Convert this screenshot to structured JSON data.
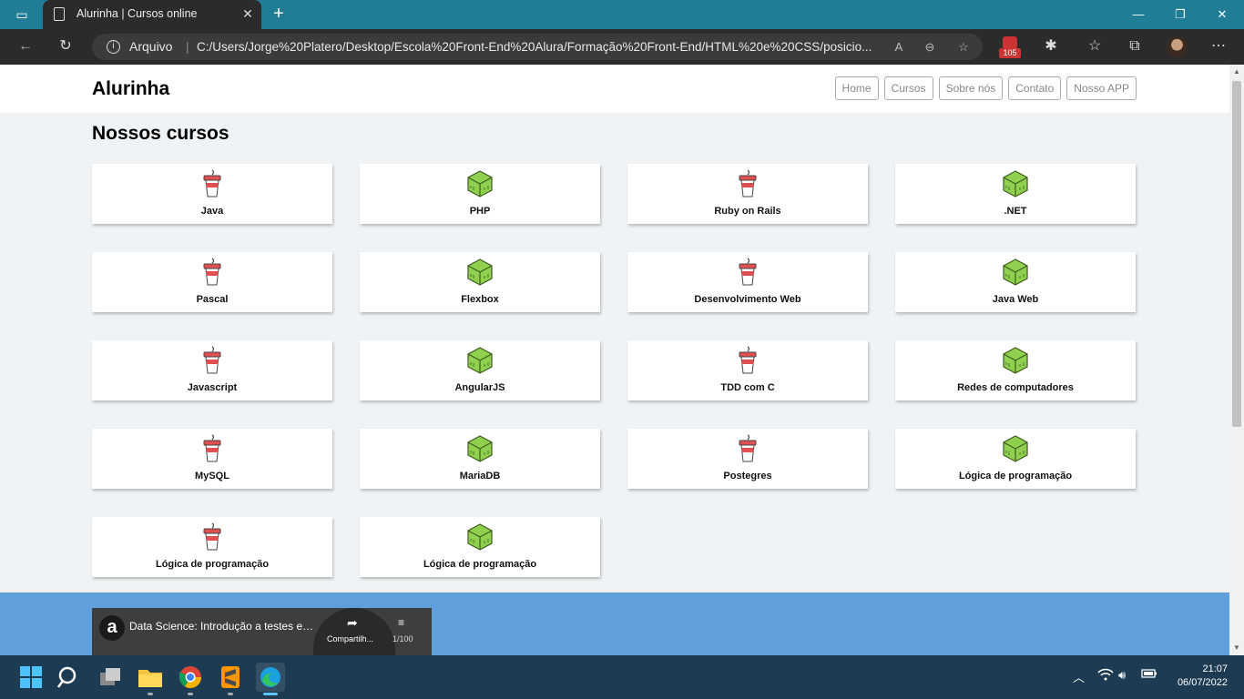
{
  "browser": {
    "tab_title": "Alurinha | Cursos online",
    "close_glyph": "✕",
    "new_tab_glyph": "+",
    "window_controls": [
      "—",
      "❐",
      "✕"
    ],
    "address": {
      "protocol_label": "Arquivo",
      "separator": "|",
      "url": "C:/Users/Jorge%20Platero/Desktop/Escola%20Front-End%20Alura/Formação%20Front-End/HTML%20e%20CSS/posicio..."
    },
    "extension_badge_count": "105"
  },
  "site": {
    "logo": "Alurinha",
    "nav": [
      "Home",
      "Cursos",
      "Sobre nós",
      "Contato",
      "Nosso APP"
    ],
    "section_title": "Nossos cursos",
    "courses": [
      {
        "name": "Java",
        "icon": "cup-icon"
      },
      {
        "name": "PHP",
        "icon": "cube-icon"
      },
      {
        "name": "Ruby on Rails",
        "icon": "cup-icon"
      },
      {
        "name": ".NET",
        "icon": "cube-icon"
      },
      {
        "name": "Pascal",
        "icon": "cup-icon"
      },
      {
        "name": "Flexbox",
        "icon": "cube-icon"
      },
      {
        "name": "Desenvolvimento Web",
        "icon": "cup-icon"
      },
      {
        "name": "Java Web",
        "icon": "cube-icon"
      },
      {
        "name": "Javascript",
        "icon": "cup-icon"
      },
      {
        "name": "AngularJS",
        "icon": "cube-icon"
      },
      {
        "name": "TDD com C",
        "icon": "cup-icon"
      },
      {
        "name": "Redes de computadores",
        "icon": "cube-icon"
      },
      {
        "name": "MySQL",
        "icon": "cup-icon"
      },
      {
        "name": "MariaDB",
        "icon": "cube-icon"
      },
      {
        "name": "Postegres",
        "icon": "cup-icon"
      },
      {
        "name": "Lógica de programação",
        "icon": "cube-icon"
      },
      {
        "name": "Lógica de programação",
        "icon": "cup-icon"
      },
      {
        "name": "Lógica de programação",
        "icon": "cube-icon"
      }
    ],
    "video": {
      "channel_letter": "a",
      "title": "Data Science: Introdução a testes est...",
      "share_label": "Compartilh...",
      "playlist_count": "1/100"
    }
  },
  "taskbar": {
    "time": "21:07",
    "date": "06/07/2022"
  },
  "colors": {
    "tabbar": "#1f7d95",
    "footer": "#5f9fdb",
    "cup_red": "#e05050",
    "cube_green": "#8fd14f"
  }
}
